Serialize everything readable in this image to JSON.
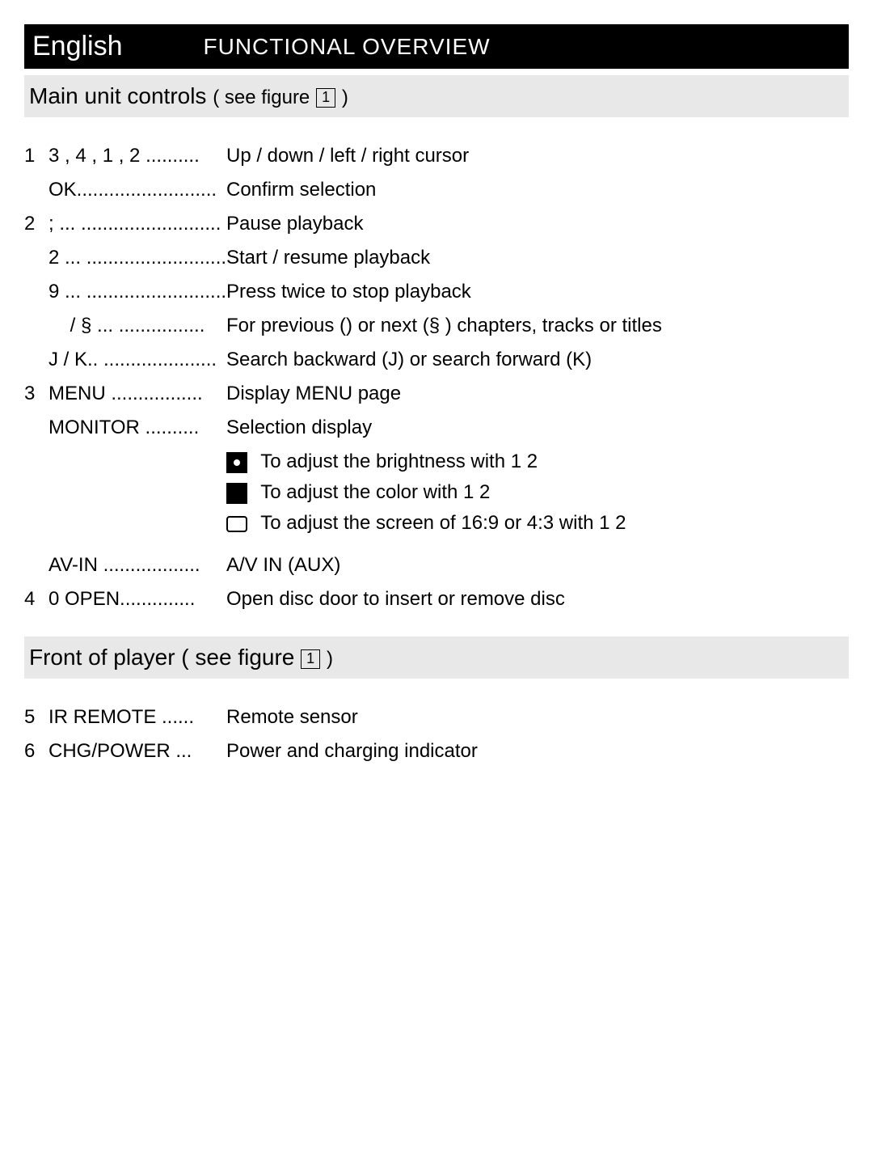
{
  "header": {
    "lang": "English",
    "title": "FUNCTIONAL OVERVIEW"
  },
  "section1": {
    "title": "Main unit controls",
    "sub": "( see figure",
    "fig": "1",
    "close": ")"
  },
  "items": {
    "n1": "1",
    "l1": "3 , 4 , 1 , 2 ..........",
    "d1": "Up / down / left / right cursor",
    "l1b": "OK..........................",
    "d1b": "Confirm selection",
    "n2": "2",
    "l2": "; ... ..........................",
    "d2": "Pause playback",
    "l2b": "2 ... ..........................",
    "d2b": "Start / resume playback",
    "l2c": "9 ... ..........................",
    "d2c": "Press twice to stop playback",
    "l2d": "    / § ... ................",
    "d2d": "For previous () or next (§ ) chapters, tracks or titles",
    "l2e": "J / K.. .....................",
    "d2e": "Search backward (J) or search forward (K)",
    "n3": "3",
    "l3": "MENU .................",
    "d3": "Display MENU page",
    "l3b": "MONITOR ..........",
    "d3b": "Selection display",
    "m1": "To adjust the brightness with 1 2",
    "m2": "To adjust the color with 1 2",
    "m3": "To adjust the screen of 16:9 or 4:3 with 1 2",
    "l3c": "AV-IN ..................",
    "d3c": "A/V IN (AUX)",
    "n4": "4",
    "l4": "0  OPEN..............",
    "d4": "Open disc door to insert or remove disc"
  },
  "section2": {
    "title": "Front of player ( see figure",
    "fig": "1",
    "close": ")"
  },
  "front": {
    "n5": "5",
    "l5": "IR REMOTE ......",
    "d5": "Remote sensor",
    "n6": "6",
    "l6": "CHG/POWER ...",
    "d6": "Power and charging indicator"
  }
}
